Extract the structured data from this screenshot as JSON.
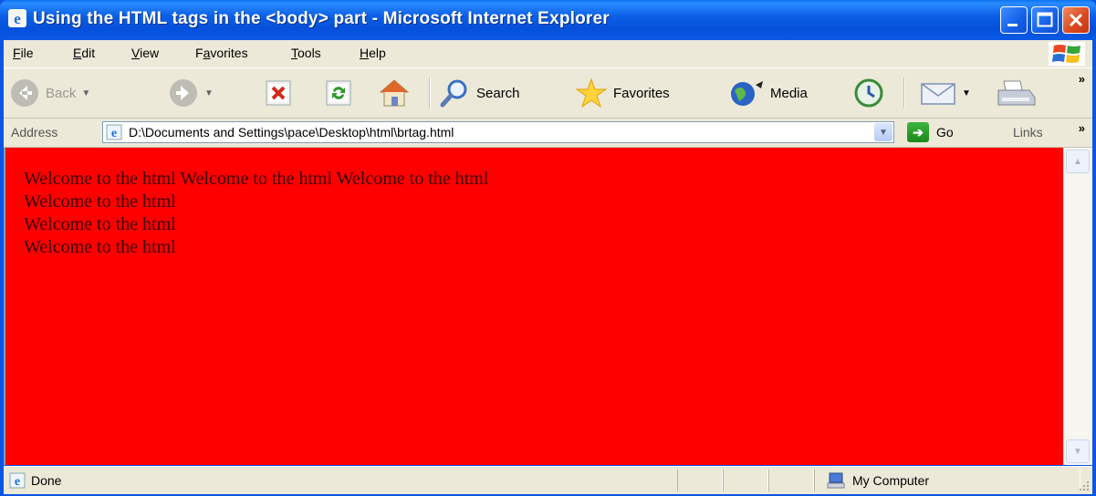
{
  "window": {
    "title": "Using the HTML tags in the <body> part - Microsoft Internet Explorer",
    "colors": {
      "title_bar": "#0a55e3",
      "content_bg": "#ff0000",
      "close": "#d8461d"
    }
  },
  "menu": {
    "items": [
      {
        "label": "File",
        "underline": "F"
      },
      {
        "label": "Edit",
        "underline": "E"
      },
      {
        "label": "View",
        "underline": "V"
      },
      {
        "label": "Favorites",
        "underline": "a"
      },
      {
        "label": "Tools",
        "underline": "T"
      },
      {
        "label": "Help",
        "underline": "H"
      }
    ]
  },
  "toolbar": {
    "back_label": "Back",
    "search_label": "Search",
    "favorites_label": "Favorites",
    "media_label": "Media",
    "more": "»"
  },
  "address": {
    "label": "Address",
    "value": "D:\\Documents and Settings\\pace\\Desktop\\html\\brtag.html",
    "go_label": "Go",
    "links_label": "Links",
    "more": "»"
  },
  "content": {
    "lines": [
      "Welcome to the html Welcome to the html Welcome to the html",
      "Welcome to the html",
      "Welcome to the html",
      "Welcome to the html"
    ]
  },
  "status": {
    "text": "Done",
    "zone": "My Computer"
  },
  "icons": [
    "ie-icon",
    "minimize-icon",
    "maximize-icon",
    "close-icon",
    "windows-logo-icon",
    "back-icon",
    "forward-icon",
    "stop-icon",
    "refresh-icon",
    "home-icon",
    "search-icon",
    "favorites-star-icon",
    "media-icon",
    "history-icon",
    "mail-icon",
    "print-icon",
    "dropdown-icon",
    "go-arrow-icon",
    "computer-icon"
  ]
}
